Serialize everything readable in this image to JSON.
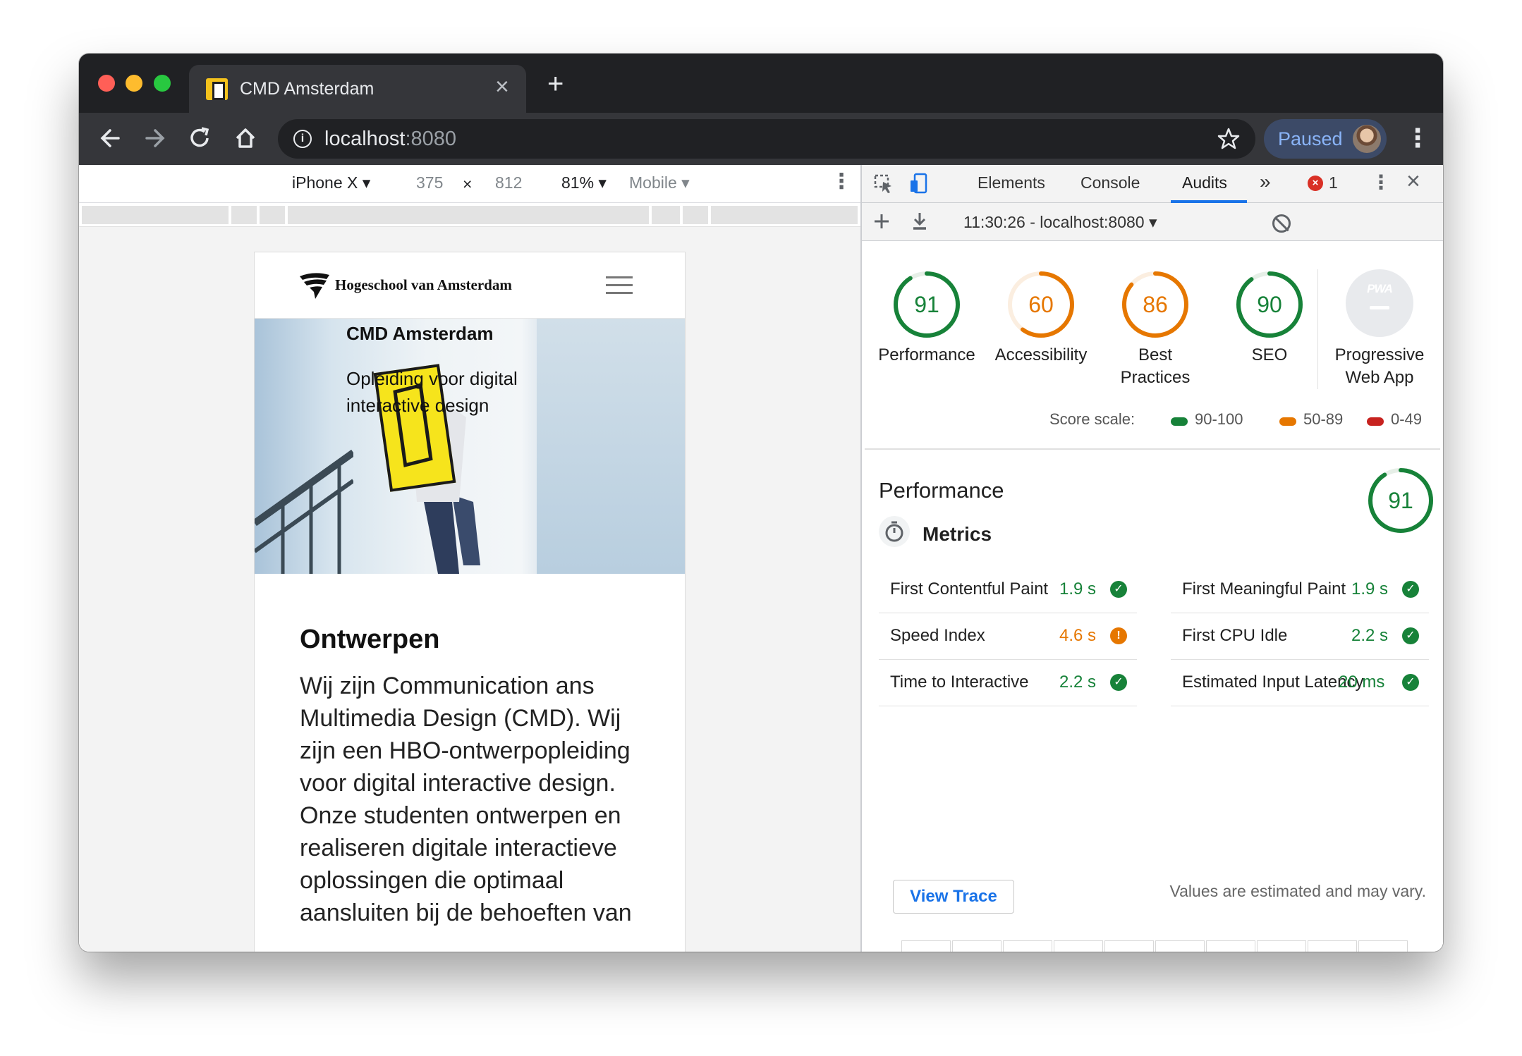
{
  "browser": {
    "tab_title": "CMD Amsterdam",
    "tab_close_glyph": "×",
    "new_tab_glyph": "+",
    "url_host": "localhost",
    "url_port": ":8080",
    "profile_label": "Paused",
    "icons": [
      "back-icon",
      "forward-icon",
      "reload-icon",
      "home-icon",
      "info-icon",
      "star-icon",
      "avatar",
      "menu-icon"
    ],
    "colors": {
      "frame": "#202124",
      "toolbar": "#35363a",
      "omnibox": "#202124",
      "accent": "#8ab4f8"
    }
  },
  "device_toolbar": {
    "device": "iPhone X",
    "width": "375",
    "times": "×",
    "height": "812",
    "zoom": "81%",
    "throttle": "Mobile"
  },
  "site": {
    "logo_text": "Hogeschool van Amsterdam",
    "hero_title": "CMD Amsterdam",
    "hero_subtitle": "Opleiding voor digital interactive design",
    "section_title": "Ontwerpen",
    "section_body": "Wij zijn Communication ans Multimedia Design (CMD). Wij zijn een HBO-ontwerpopleiding voor digital interactive design. Onze studenten ontwerpen en realiseren digitale interactieve oplossingen die optimaal aansluiten bij de behoeften van"
  },
  "devtools": {
    "tabs": [
      "Elements",
      "Console",
      "Audits"
    ],
    "active_tab": "Audits",
    "more_glyph": "»",
    "error_count": "1",
    "report_selector": "11:30:26 - localhost:8080 ▾",
    "categories": [
      {
        "score": "91",
        "label": "Performance",
        "color": "#178239",
        "value": 0.91
      },
      {
        "score": "60",
        "label": "Accessibility",
        "color": "#e67700",
        "value": 0.6
      },
      {
        "score": "86",
        "label": "Best Practices",
        "color": "#e67700",
        "value": 0.86
      },
      {
        "score": "90",
        "label": "SEO",
        "color": "#178239",
        "value": 0.9
      }
    ],
    "pwa": {
      "badge": "PWA",
      "label": "Progressive Web App"
    },
    "score_scale": {
      "label": "Score scale:",
      "ranges": [
        {
          "text": "90-100",
          "color": "#178239"
        },
        {
          "text": "50-89",
          "color": "#e67700"
        },
        {
          "text": "0-49",
          "color": "#c7221f"
        }
      ]
    },
    "performance": {
      "title": "Performance",
      "score": "91",
      "metrics_title": "Metrics",
      "metrics": [
        {
          "name": "First Contentful Paint",
          "value": "1.9 s",
          "status": "pass"
        },
        {
          "name": "First Meaningful Paint",
          "value": "1.9 s",
          "status": "pass"
        },
        {
          "name": "Speed Index",
          "value": "4.6 s",
          "status": "average"
        },
        {
          "name": "First CPU Idle",
          "value": "2.2 s",
          "status": "pass"
        },
        {
          "name": "Time to Interactive",
          "value": "2.2 s",
          "status": "pass"
        },
        {
          "name": "Estimated Input Latency",
          "value": "20 ms",
          "status": "pass"
        }
      ],
      "view_trace": "View Trace",
      "estimated_note": "Values are estimated and may vary."
    }
  }
}
